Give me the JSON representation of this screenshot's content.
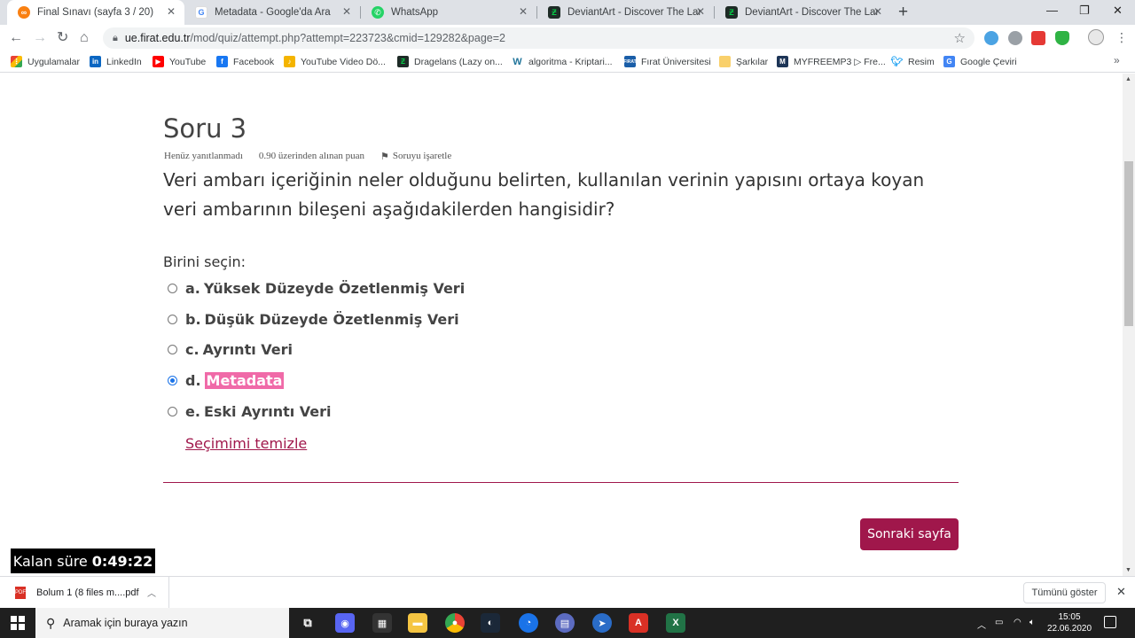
{
  "browser": {
    "tabs": [
      {
        "title": "Final Sınavı (sayfa 3 / 20)",
        "active": true,
        "icon": "moodle-icon",
        "color": "#f98012"
      },
      {
        "title": "Metadata - Google'da Ara",
        "active": false,
        "icon": "google-icon",
        "color": "#4285f4"
      },
      {
        "title": "WhatsApp",
        "active": false,
        "icon": "whatsapp-icon",
        "color": "#25d366"
      },
      {
        "title": "DeviantArt - Discover The Larges",
        "active": false,
        "icon": "deviantart-icon",
        "color": "#05cc47"
      },
      {
        "title": "DeviantArt - Discover The Larges",
        "active": false,
        "icon": "deviantart-icon",
        "color": "#05cc47"
      }
    ],
    "url_host": "ue.firat.edu.tr",
    "url_path": "/mod/quiz/attempt.php?attempt=223723&cmid=129282&page=2",
    "bookmarks": [
      {
        "label": "Uygulamalar",
        "icon": "apps-grid-icon",
        "color": "#ea4335"
      },
      {
        "label": "LinkedIn",
        "icon": "linkedin-icon",
        "color": "#0a66c2"
      },
      {
        "label": "YouTube",
        "icon": "youtube-icon",
        "color": "#ff0000"
      },
      {
        "label": "Facebook",
        "icon": "facebook-icon",
        "color": "#1877f2"
      },
      {
        "label": "YouTube Video Dö...",
        "icon": "converter-icon",
        "color": "#f4b400"
      },
      {
        "label": "Dragelans (Lazy on...",
        "icon": "deviantart-icon",
        "color": "#05cc47"
      },
      {
        "label": "algoritma - Kriptari...",
        "icon": "wordpress-icon",
        "color": "#21759b"
      },
      {
        "label": "Fırat Üniversitesi",
        "icon": "university-icon",
        "color": "#1a5ea8"
      },
      {
        "label": "Şarkılar",
        "icon": "folder-icon",
        "color": "#f9d06b"
      },
      {
        "label": "MYFREEMP3 ▷ Fre...",
        "icon": "mp3-icon",
        "color": "#1d3557"
      },
      {
        "label": "Resim",
        "icon": "twitter-icon",
        "color": "#1da1f2"
      },
      {
        "label": "Google Çeviri",
        "icon": "translate-icon",
        "color": "#4285f4"
      }
    ]
  },
  "quiz": {
    "question_title": "Soru 3",
    "status": "Henüz yanıtlanmadı",
    "points": "0.90 üzerinden alınan puan",
    "flag_label": "Soruyu işaretle",
    "question_text": "Veri ambarı içeriğinin neler olduğunu belirten, kullanılan verinin yapısını ortaya koyan veri ambarının bileşeni aşağıdakilerden hangisidir?",
    "prompt": "Birini seçin:",
    "answers": [
      {
        "letter": "a.",
        "text": "Yüksek Düzeyde Özetlenmiş Veri",
        "selected": false
      },
      {
        "letter": "b.",
        "text": "Düşük Düzeyde Özetlenmiş Veri",
        "selected": false
      },
      {
        "letter": "c.",
        "text": "Ayrıntı Veri",
        "selected": false
      },
      {
        "letter": "d.",
        "text": "Metadata",
        "selected": true
      },
      {
        "letter": "e.",
        "text": "Eski Ayrıntı Veri",
        "selected": false
      }
    ],
    "clear_label": "Seçimimi temizle",
    "next_label": "Sonraki sayfa",
    "timer_label": "Kalan süre",
    "timer_value": "0:49:22"
  },
  "colors": {
    "accent": "#a0174b",
    "highlight": "#f06aa8"
  },
  "downloads": {
    "file": "Bolum 1 (8 files m....pdf",
    "show_all": "Tümünü göster"
  },
  "taskbar": {
    "search_placeholder": "Aramak için buraya yazın",
    "time": "15:05",
    "date": "22.06.2020"
  }
}
